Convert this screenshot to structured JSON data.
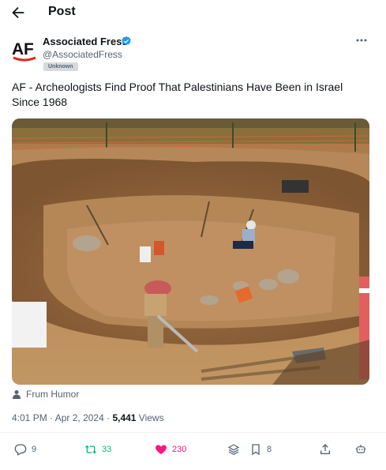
{
  "header": {
    "title": "Post",
    "back_icon": "arrow-left-icon"
  },
  "author": {
    "initials": "AF",
    "name": "Associated Fress",
    "handle": "@AssociatedFress",
    "badge": "Unknown",
    "verified": true,
    "verified_color": "#1d9bf0"
  },
  "tweet": {
    "text": "AF - Archeologists Find Proof That Palestinians Have Been in Israel Since 1968"
  },
  "media": {
    "description_icon": "photo-excavation-site"
  },
  "credit": {
    "icon": "person-icon",
    "text": "Frum Humor"
  },
  "meta": {
    "time": "4:01 PM",
    "sep1": " · ",
    "date": "Apr 2, 2024",
    "sep2": " · ",
    "views_count": "5,441",
    "views_label": " Views"
  },
  "actions": {
    "replies": "9",
    "reposts": "33",
    "likes": "230",
    "bookmarks": "8"
  },
  "colors": {
    "repost": "#00ba7c",
    "like": "#f91880",
    "muted": "#536471"
  }
}
